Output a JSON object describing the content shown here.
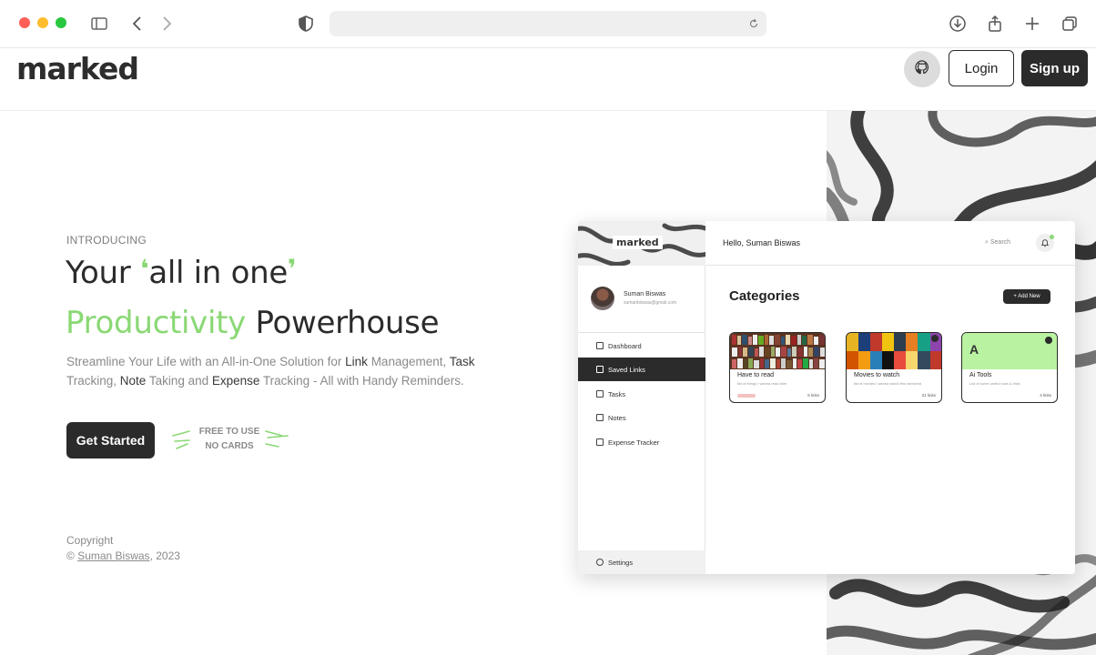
{
  "site": {
    "logo": "marked",
    "login_label": "Login",
    "signup_label": "Sign up"
  },
  "hero": {
    "intro": "INTRODUCING",
    "line1_a": "Your",
    "line1_b": "all in one",
    "line2_a": "Productivity",
    "line2_b": "Powerhouse",
    "desc_1": "Streamline Your Life with an All-in-One Solution for ",
    "desc_link": "Link",
    "desc_2": " Management, ",
    "desc_task": "Task",
    "desc_3": " Tracking, ",
    "desc_note": "Note",
    "desc_4": " Taking and ",
    "desc_expense": "Expense",
    "desc_5": " Tracking - All with Handy Reminders.",
    "cta_label": "Get Started",
    "free_line1": "FREE TO USE",
    "free_line2": "NO CARDS"
  },
  "footer": {
    "copyright_label": "Copyright",
    "copyright_symbol": "©",
    "author": "Suman Biswas",
    "year": ", 2023"
  },
  "mockup": {
    "logo": "marked",
    "user_name": "Suman Biswas",
    "user_email": "sumanbiswas@gmail.com",
    "nav": [
      {
        "label": "Dashboard"
      },
      {
        "label": "Saved Links"
      },
      {
        "label": "Tasks"
      },
      {
        "label": "Notes"
      },
      {
        "label": "Expense Tracker"
      }
    ],
    "settings": "Settings",
    "greeting": "Hello, Suman Biswas",
    "search": "Search",
    "categories_title": "Categories",
    "add_new": "+ Add New",
    "cards": [
      {
        "title": "Have to read",
        "subtitle": "list of things I wanna read later",
        "count": "6 links"
      },
      {
        "title": "Movies to watch",
        "subtitle": "list of movies I wanna watch this weekend",
        "count": "21 links"
      },
      {
        "title": "Ai Tools",
        "letter": "A",
        "subtitle": "List of some useful tools & links",
        "count": "4 links"
      }
    ]
  },
  "colors": {
    "accent": "#8ad875",
    "dark": "#2b2b2b"
  }
}
